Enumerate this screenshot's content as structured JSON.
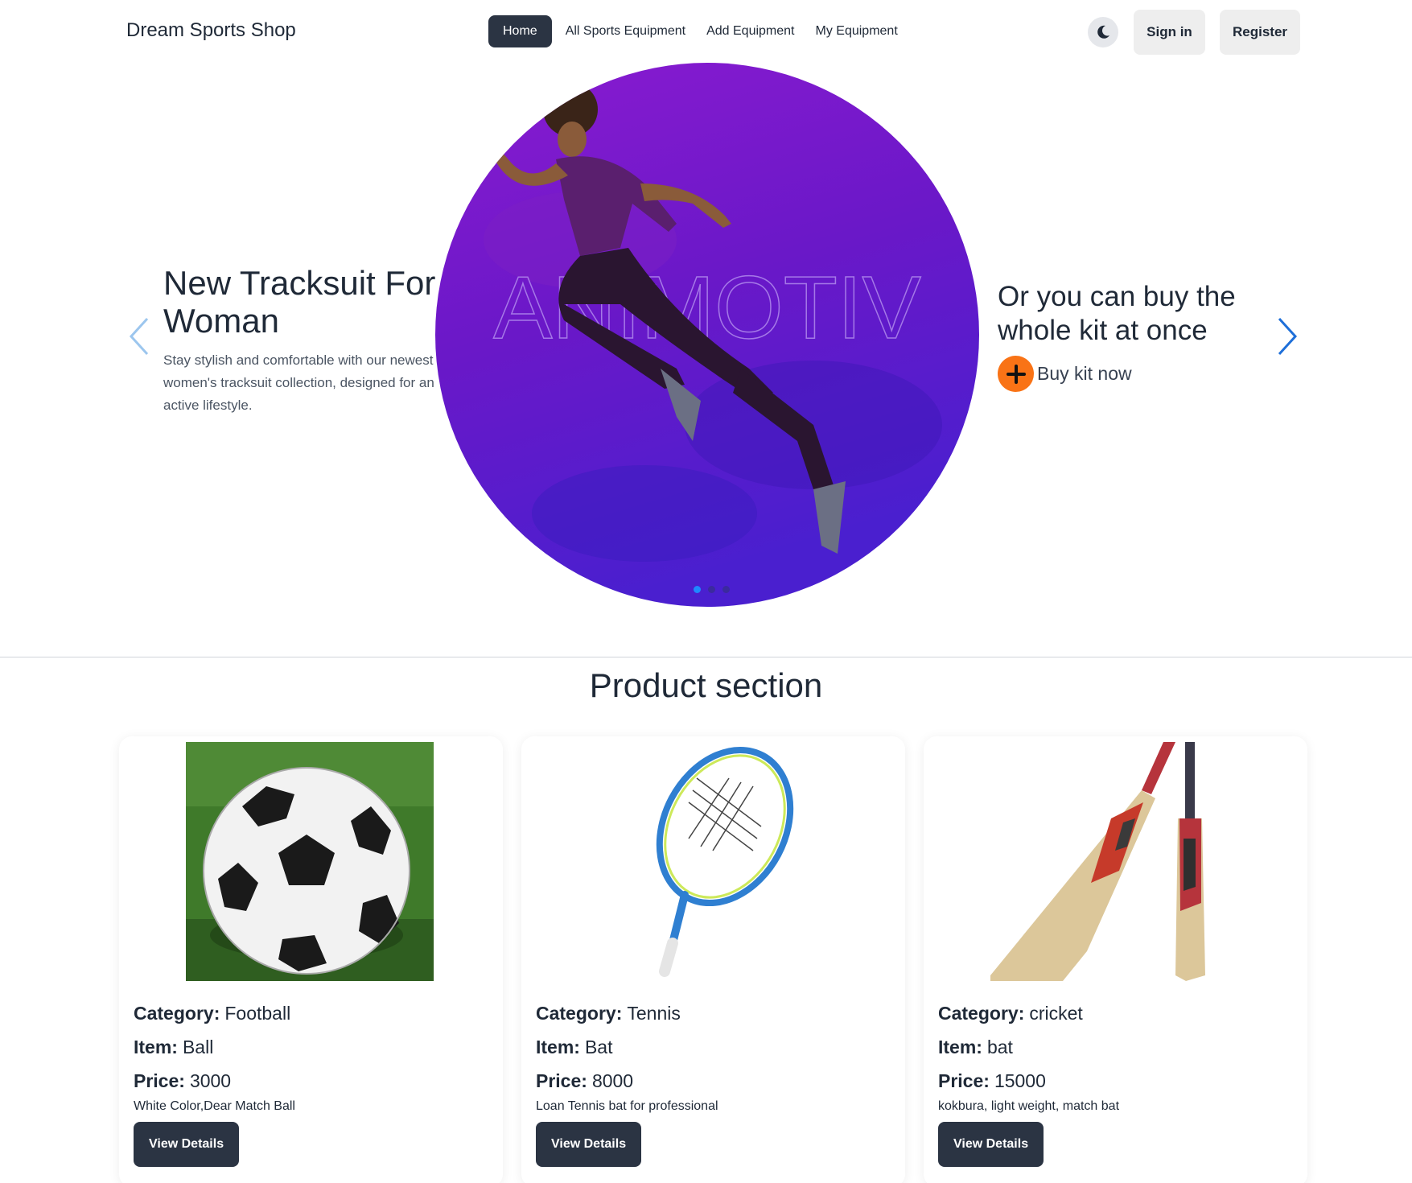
{
  "nav": {
    "brand": "Dream Sports Shop",
    "links": [
      "Home",
      "All Sports Equipment",
      "Add Equipment",
      "My Equipment"
    ],
    "active_link": "Home",
    "sign_in": "Sign in",
    "register": "Register",
    "theme_icon": "moon-icon"
  },
  "hero": {
    "left_title": "New Tracksuit For Woman",
    "left_description": "Stay stylish and comfortable with our newest women's tracksuit collection, designed for an active lifestyle.",
    "image_overlay_text": "ANIMOTIV",
    "right_title": "Or you can buy the whole kit at once",
    "buy_label": "Buy kit now",
    "accent_color": "#f97316",
    "slide_count": 3,
    "active_slide": 1
  },
  "products": {
    "section_title": "Product section",
    "labels": {
      "category": "Category:",
      "item": "Item:",
      "price": "Price:",
      "button": "View Details"
    },
    "items": [
      {
        "category": "Football",
        "item": "Ball",
        "price": "3000",
        "description": "White Color,Dear Match Ball",
        "image": "soccer-ball-image"
      },
      {
        "category": "Tennis",
        "item": "Bat",
        "price": "8000",
        "description": "Loan Tennis bat for professional",
        "image": "tennis-racket-image"
      },
      {
        "category": "cricket",
        "item": "bat",
        "price": "15000",
        "description": "kokbura, light weight, match bat",
        "image": "cricket-bat-image"
      }
    ]
  }
}
